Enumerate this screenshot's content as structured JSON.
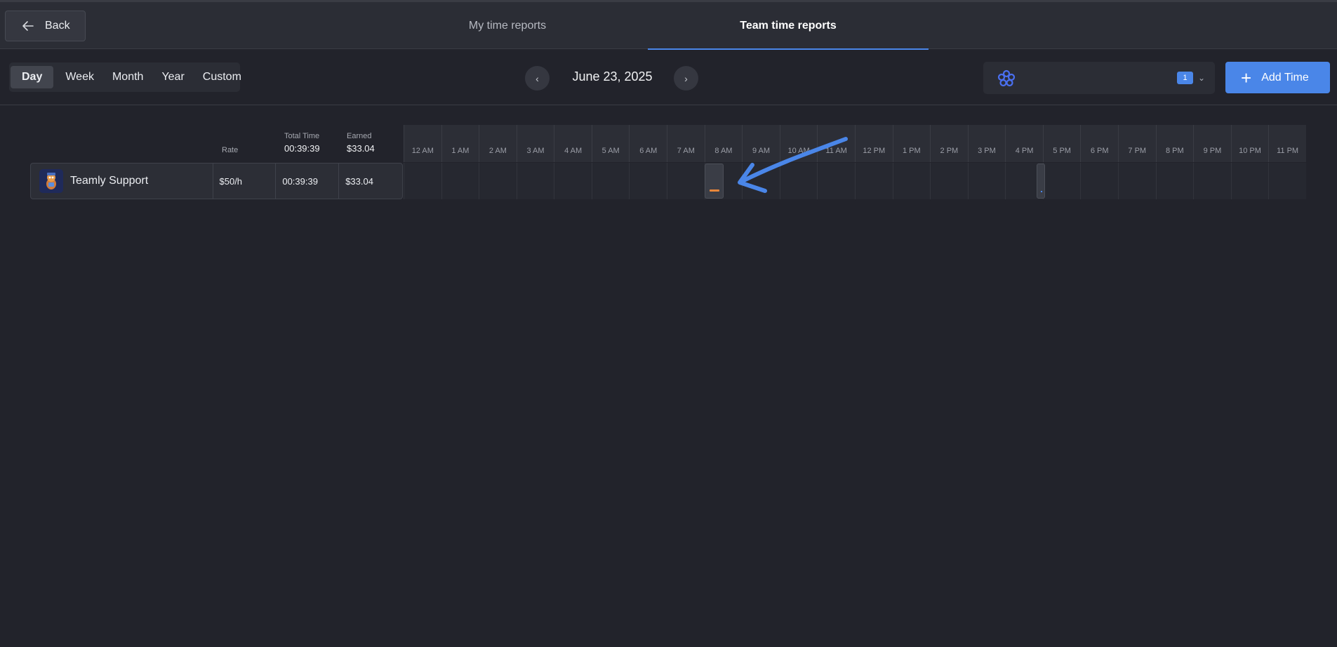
{
  "header": {
    "back_label": "Back",
    "tabs": [
      {
        "label": "My time reports",
        "active": false
      },
      {
        "label": "Team time reports",
        "active": true
      }
    ]
  },
  "toolbar": {
    "ranges": [
      "Day",
      "Week",
      "Month",
      "Year",
      "Custom"
    ],
    "active_range": "Day",
    "date": "June 23, 2025",
    "prev_icon": "chevron-left-icon",
    "next_icon": "chevron-right-icon",
    "team_select": {
      "badge_count": "1",
      "logo_icon": "team-logo-icon"
    },
    "add_time_label": "Add Time"
  },
  "report": {
    "rate_label": "Rate",
    "total_label": "Total Time",
    "total_value": "00:39:39",
    "earned_label": "Earned",
    "earned_value": "$33.04",
    "hours": [
      "12 AM",
      "1 AM",
      "2 AM",
      "3 AM",
      "4 AM",
      "5 AM",
      "6 AM",
      "7 AM",
      "8 AM",
      "9 AM",
      "10 AM",
      "11 AM",
      "12 PM",
      "1 PM",
      "2 PM",
      "3 PM",
      "4 PM",
      "5 PM",
      "6 PM",
      "7 PM",
      "8 PM",
      "9 PM",
      "10 PM",
      "11 PM"
    ],
    "members": [
      {
        "name": "Teamly Support",
        "rate": "$50/h",
        "total": "00:39:39",
        "earned": "$33.04"
      }
    ]
  },
  "colors": {
    "accent": "#4a86e8",
    "activity_bar": "#e8873a",
    "background": "#22232b"
  }
}
